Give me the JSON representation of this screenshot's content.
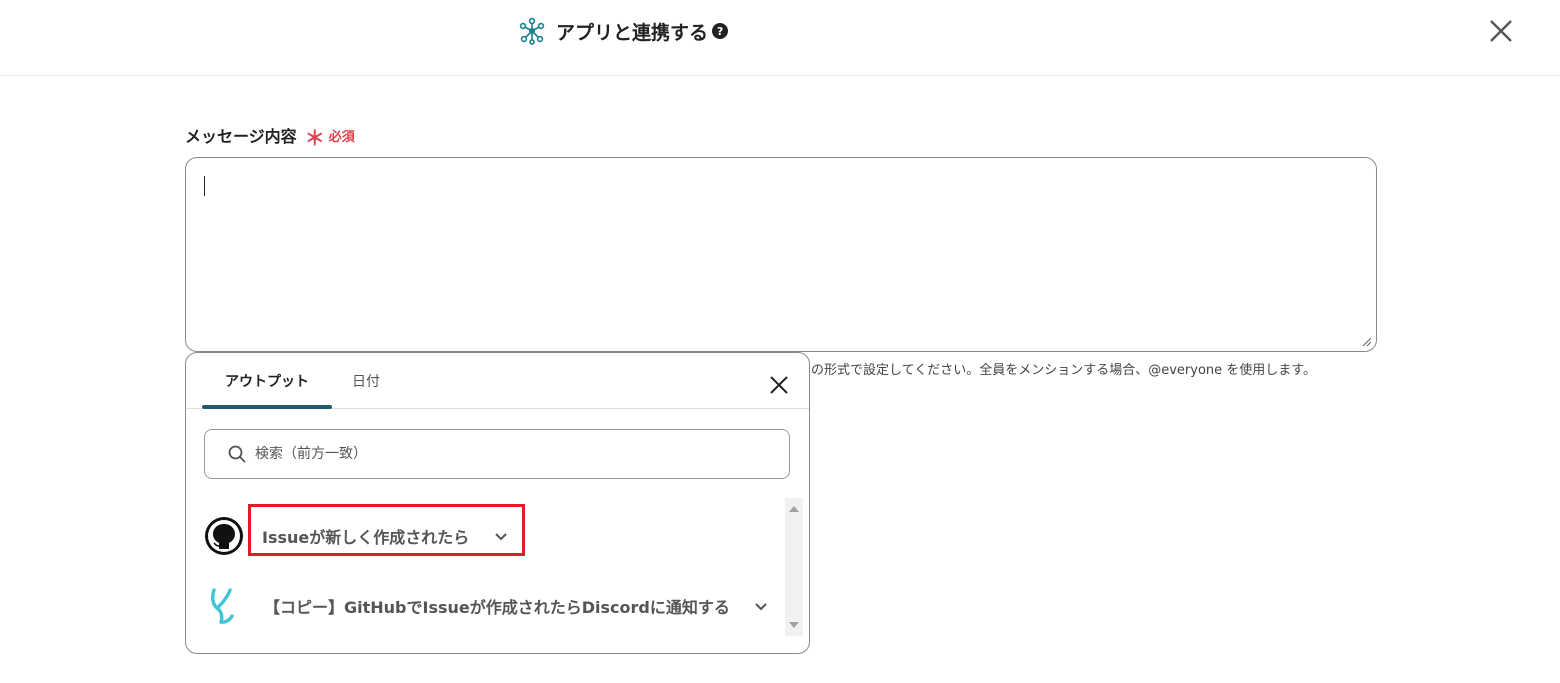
{
  "header": {
    "title": "アプリと連携する",
    "help_label": "?",
    "app_icon": "hub-network-icon",
    "close_icon": "close-icon"
  },
  "field": {
    "label": "メッセージ内容",
    "required_mark": "＊",
    "required_text": "必須",
    "value": "",
    "hint": "の形式で設定してください。全員をメンションする場合、@everyone を使用します。"
  },
  "popup": {
    "tabs": [
      {
        "label": "アウトプット",
        "active": true
      },
      {
        "label": "日付",
        "active": false
      }
    ],
    "search": {
      "placeholder": "検索（前方一致）",
      "value": ""
    },
    "items": [
      {
        "label": "Issueが新しく作成されたら",
        "icon": "github-icon",
        "expanded": false,
        "highlighted": true
      },
      {
        "label": "【コピー】GitHubでIssueが作成されたらDiscordに通知する",
        "icon": "yoom-logo-icon",
        "expanded": false,
        "highlighted": false
      }
    ]
  },
  "colors": {
    "accent": "#1f5a6e",
    "required": "#e0404e",
    "highlight": "#e11d2a",
    "icon_teal": "#1a7f8e",
    "yoom_cyan": "#3cc6d6"
  }
}
